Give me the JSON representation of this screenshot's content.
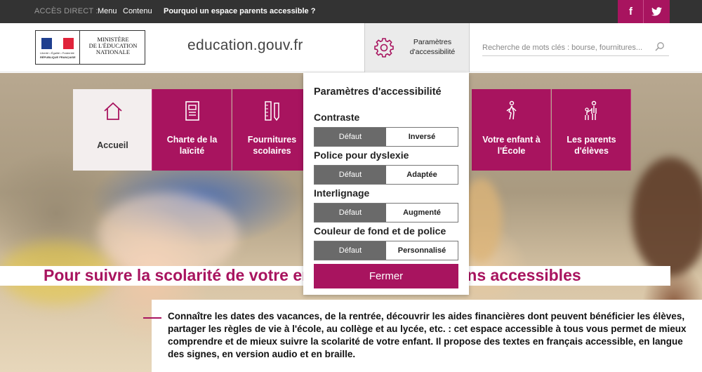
{
  "topbar": {
    "quick_access": "ACCÈS DIRECT :",
    "menu": "Menu",
    "content": "Contenu",
    "parents_link": "Pourquoi un espace parents accessible ?",
    "facebook": "f"
  },
  "header": {
    "logo_line1": "MINISTÈRE",
    "logo_line2": "DE L'ÉDUCATION",
    "logo_line3": "NATIONALE",
    "logo_motto": "Liberté • Égalité • Fraternité",
    "logo_republic": "RÉPUBLIQUE FRANÇAISE",
    "site_name": "education.gouv.fr",
    "access_label": "Paramètres d'accessibilité",
    "search_placeholder": "Recherche de mots clés : bourse, fournitures..."
  },
  "nav": {
    "tiles": [
      {
        "label": "Accueil",
        "icon": "home-icon"
      },
      {
        "label": "Charte de la laïcité",
        "icon": "document-icon"
      },
      {
        "label": "Fournitures scolaires",
        "icon": "school-supplies-icon"
      },
      {
        "label": "Votre enfant à l'École",
        "icon": "child-walking-icon"
      },
      {
        "label": "Les parents d'élèves",
        "icon": "parent-child-icon"
      }
    ]
  },
  "popup": {
    "title": "Paramètres d'accessibilité",
    "sections": [
      {
        "label": "Contraste",
        "default": "Défaut",
        "alt": "Inversé"
      },
      {
        "label": "Police pour dyslexie",
        "default": "Défaut",
        "alt": "Adaptée"
      },
      {
        "label": "Interlignage",
        "default": "Défaut",
        "alt": "Augmenté"
      },
      {
        "label": "Couleur de fond et de police",
        "default": "Défaut",
        "alt": "Personnalisé"
      }
    ],
    "close": "Fermer"
  },
  "main": {
    "title": "Pour suivre la scolarité de votre enfant : des informations accessibles",
    "intro": "Connaître les dates des vacances, de la rentrée, découvrir les aides financières dont peuvent bénéficier les élèves, partager les règles de vie à l'école, au collège et au lycée, etc. : cet espace accessible à tous vous permet de mieux comprendre et de mieux suivre la scolarité de votre enfant. Il propose des textes en français accessible, en langue des signes, en version audio et en braille."
  },
  "colors": {
    "accent": "#a8145f",
    "topbar": "#333333",
    "toggle_active": "#6a6a6a"
  }
}
